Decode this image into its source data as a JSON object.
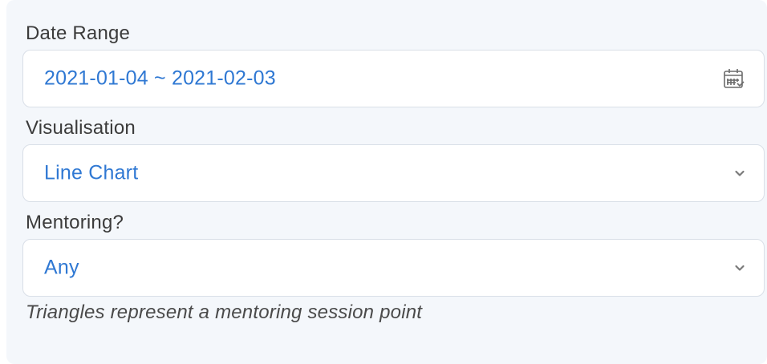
{
  "filters": {
    "date_range": {
      "label": "Date Range",
      "value": "2021-01-04 ~ 2021-02-03",
      "icon": "calendar-icon"
    },
    "visualisation": {
      "label": "Visualisation",
      "value": "Line Chart",
      "icon": "chevron-down-icon"
    },
    "mentoring": {
      "label": "Mentoring?",
      "value": "Any",
      "icon": "chevron-down-icon"
    },
    "hint": "Triangles represent a mentoring session point"
  },
  "colors": {
    "value_text": "#2f78d3",
    "label_text": "#3b3b3b",
    "panel_bg": "#f4f7fb",
    "field_border": "#d9dfe7"
  }
}
